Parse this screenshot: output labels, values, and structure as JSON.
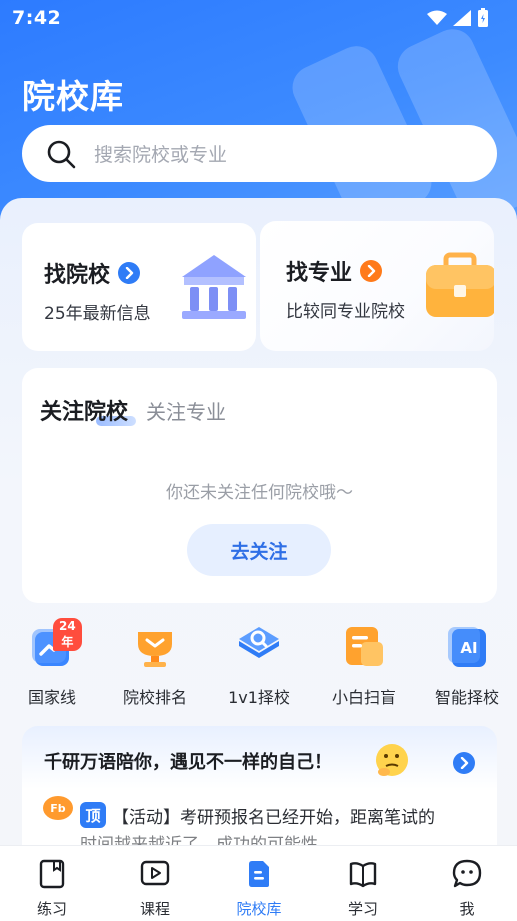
{
  "status": {
    "time": "7:42"
  },
  "header": {
    "title": "院校库"
  },
  "search": {
    "placeholder": "搜索院校或专业"
  },
  "find_cards": [
    {
      "title": "找院校",
      "subtitle": "25年最新信息",
      "accent": "#2f7cf6",
      "icon": "bank-building-icon"
    },
    {
      "title": "找专业",
      "subtitle": "比较同专业院校",
      "accent": "#ff7a1a",
      "icon": "briefcase-icon"
    }
  ],
  "follow": {
    "tabs": [
      "关注院校",
      "关注专业"
    ],
    "empty_text": "你还未关注任何院校哦～",
    "button": "去关注"
  },
  "quick_actions": [
    {
      "label": "国家线",
      "badge": "24年",
      "icon": "trend-chart-icon"
    },
    {
      "label": "院校排名",
      "icon": "trophy-icon"
    },
    {
      "label": "1v1择校",
      "icon": "search-shield-icon"
    },
    {
      "label": "小白扫盲",
      "icon": "document-icon"
    },
    {
      "label": "智能择校",
      "icon": "ai-icon"
    }
  ],
  "promo": {
    "title": "千研万语陪你，遇见不一样的自己！",
    "tag": "顶",
    "news": "【活动】考研预报名已经开始，距离笔试的",
    "news_next": "时间越来越近了，成功的可能性"
  },
  "tabbar": [
    {
      "label": "练习",
      "icon": "book-icon"
    },
    {
      "label": "课程",
      "icon": "video-play-icon"
    },
    {
      "label": "院校库",
      "icon": "school-library-icon",
      "active": true
    },
    {
      "label": "学习",
      "icon": "open-book-icon"
    },
    {
      "label": "我",
      "icon": "chat-face-icon"
    }
  ],
  "colors": {
    "primary": "#2f7cf6",
    "orange": "#ff7a1a",
    "badge": "#ff4d3d"
  }
}
